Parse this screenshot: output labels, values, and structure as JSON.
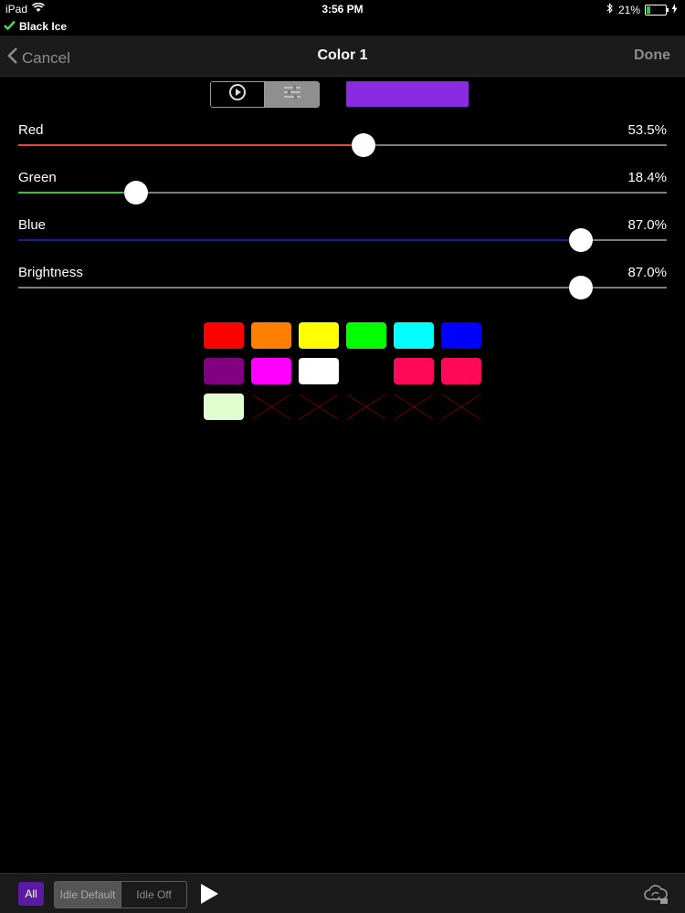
{
  "status_bar": {
    "device": "iPad",
    "time": "3:56 PM",
    "battery_text": "21%",
    "battery_level": 0.21,
    "icons": [
      "wifi-icon",
      "bluetooth-icon",
      "battery-icon",
      "charging-icon"
    ]
  },
  "app": {
    "name": "Black Ice",
    "check_color": "#4cd964"
  },
  "nav": {
    "cancel_label": "Cancel",
    "title": "Color 1",
    "done_label": "Done"
  },
  "mode_toggle": {
    "selected": "play",
    "icons": [
      "play-circle-icon",
      "sliders-icon"
    ]
  },
  "preview_color": "#8a2be2",
  "sliders": [
    {
      "label": "Red",
      "value_text": "53.5%",
      "value": 0.535,
      "fill_color": "#e54a3c"
    },
    {
      "label": "Green",
      "value_text": "18.4%",
      "value": 0.184,
      "fill_color": "#39c43a"
    },
    {
      "label": "Blue",
      "value_text": "87.0%",
      "value": 0.87,
      "fill_color": "#1a1f9c"
    },
    {
      "label": "Brightness",
      "value_text": "87.0%",
      "value": 0.87,
      "fill_color": "#7d7d7d"
    }
  ],
  "palette": [
    [
      "#ff0000",
      "#ff8000",
      "#ffff00",
      "#00ff00",
      "#00ffff",
      "#0000ff"
    ],
    [
      "#800080",
      "#ff00ff",
      "#ffffff",
      null,
      "#ff0a5a",
      "#ff0a5a"
    ],
    [
      "#e0ffd0",
      "empty",
      "empty",
      "empty",
      "empty",
      "empty"
    ]
  ],
  "bottom": {
    "all_label": "All",
    "idle_default_label": "Idle Default",
    "idle_off_label": "Idle Off",
    "icons": [
      "play-icon",
      "cloud-sync-icon"
    ]
  }
}
